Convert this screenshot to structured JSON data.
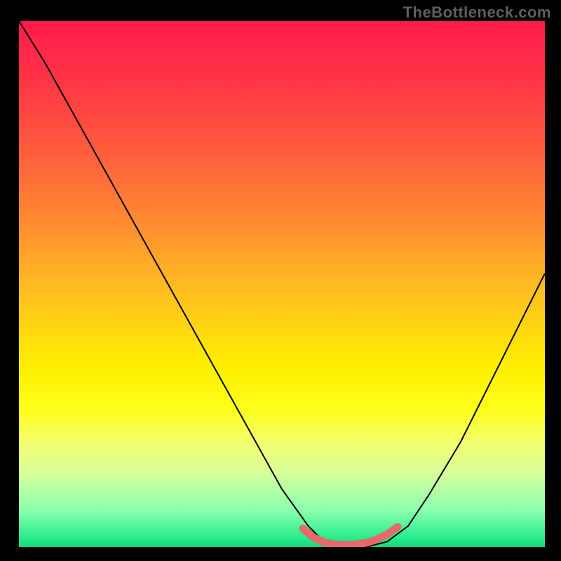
{
  "watermark": {
    "text": "TheBottleneck.com"
  },
  "chart_data": {
    "type": "line",
    "title": "",
    "xlabel": "",
    "ylabel": "",
    "xlim": [
      0,
      100
    ],
    "ylim": [
      0,
      100
    ],
    "grid": false,
    "background": {
      "type": "vertical-gradient",
      "stops": [
        {
          "offset": 0.0,
          "color": "#ff1a4b"
        },
        {
          "offset": 0.12,
          "color": "#ff3745"
        },
        {
          "offset": 0.24,
          "color": "#ff5a3e"
        },
        {
          "offset": 0.38,
          "color": "#ff8a32"
        },
        {
          "offset": 0.52,
          "color": "#ffc11f"
        },
        {
          "offset": 0.66,
          "color": "#fff000"
        },
        {
          "offset": 0.74,
          "color": "#fdff1a"
        },
        {
          "offset": 0.8,
          "color": "#f4ff6e"
        },
        {
          "offset": 0.86,
          "color": "#d7ff9c"
        },
        {
          "offset": 0.93,
          "color": "#8affae"
        },
        {
          "offset": 0.985,
          "color": "#24eb8a"
        },
        {
          "offset": 1.0,
          "color": "#17d87d"
        }
      ]
    },
    "series": [
      {
        "name": "bottleneck-curve",
        "stroke": "#000000",
        "stroke_width": 2,
        "x": [
          0,
          5,
          10,
          15,
          20,
          25,
          30,
          35,
          40,
          45,
          50,
          55,
          58,
          62,
          66,
          70,
          74,
          78,
          84,
          90,
          96,
          100
        ],
        "y": [
          100,
          92,
          83,
          74,
          65,
          56,
          47,
          38,
          29,
          20,
          11,
          4,
          1,
          0,
          0,
          1,
          4,
          10,
          20,
          32,
          44,
          52
        ]
      },
      {
        "name": "optimal-range-marker",
        "stroke": "#e66a6a",
        "stroke_width": 11,
        "linecap": "round",
        "x": [
          54,
          56,
          58,
          60,
          62,
          64,
          66,
          68,
          70,
          72
        ],
        "y": [
          3.5,
          1.8,
          0.9,
          0.5,
          0.4,
          0.5,
          0.8,
          1.4,
          2.4,
          3.8
        ]
      }
    ]
  }
}
